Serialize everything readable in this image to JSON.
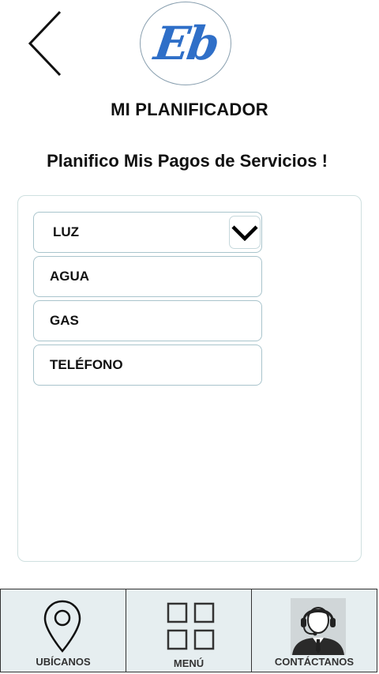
{
  "header": {
    "logo_text": "Eb",
    "title": "MI PLANIFICADOR",
    "subtitle": "Planifico Mis Pagos de Servicios !"
  },
  "services": {
    "selected": "LUZ",
    "options": [
      "AGUA",
      "GAS",
      "TELÉFONO"
    ]
  },
  "bottom_nav": {
    "items": [
      {
        "label": "UBÍCANOS",
        "icon": "location-pin-icon"
      },
      {
        "label": "MENÚ",
        "icon": "grid-menu-icon"
      },
      {
        "label": "CONTÁCTANOS",
        "icon": "support-agent-icon"
      }
    ]
  },
  "colors": {
    "logo_accent": "#2f6fc8",
    "nav_background": "#e6eef0",
    "border_accent": "#a9c4cc"
  }
}
